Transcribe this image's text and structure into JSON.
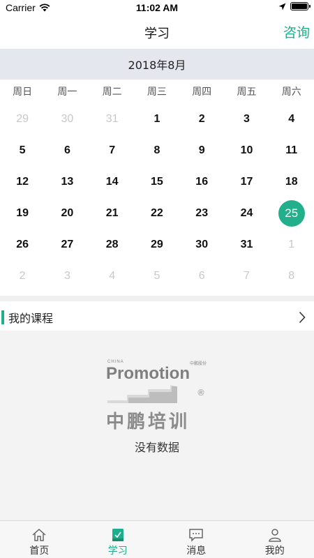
{
  "status_bar": {
    "carrier": "Carrier",
    "time": "11:02 AM"
  },
  "nav": {
    "title": "学习",
    "action": "咨询"
  },
  "calendar": {
    "month": "2018年8月",
    "weekdays": [
      "周日",
      "周一",
      "周二",
      "周三",
      "周四",
      "周五",
      "周六"
    ],
    "days": [
      {
        "d": "29",
        "muted": true
      },
      {
        "d": "30",
        "muted": true
      },
      {
        "d": "31",
        "muted": true
      },
      {
        "d": "1"
      },
      {
        "d": "2"
      },
      {
        "d": "3"
      },
      {
        "d": "4"
      },
      {
        "d": "5"
      },
      {
        "d": "6"
      },
      {
        "d": "7"
      },
      {
        "d": "8"
      },
      {
        "d": "9"
      },
      {
        "d": "10"
      },
      {
        "d": "11"
      },
      {
        "d": "12"
      },
      {
        "d": "13"
      },
      {
        "d": "14"
      },
      {
        "d": "15"
      },
      {
        "d": "16"
      },
      {
        "d": "17"
      },
      {
        "d": "18"
      },
      {
        "d": "19"
      },
      {
        "d": "20"
      },
      {
        "d": "21"
      },
      {
        "d": "22"
      },
      {
        "d": "23"
      },
      {
        "d": "24"
      },
      {
        "d": "25",
        "selected": true
      },
      {
        "d": "26"
      },
      {
        "d": "27"
      },
      {
        "d": "28"
      },
      {
        "d": "29"
      },
      {
        "d": "30"
      },
      {
        "d": "31"
      },
      {
        "d": "1",
        "muted": true
      },
      {
        "d": "2",
        "muted": true
      },
      {
        "d": "3",
        "muted": true
      },
      {
        "d": "4",
        "muted": true
      },
      {
        "d": "5",
        "muted": true
      },
      {
        "d": "6",
        "muted": true
      },
      {
        "d": "7",
        "muted": true
      },
      {
        "d": "8",
        "muted": true
      }
    ],
    "accent_color": "#22b08c"
  },
  "courses": {
    "title": "我的课程",
    "empty_text": "没有数据",
    "logo": {
      "small_left": "CHINA",
      "small_right": "中鹏股份",
      "word": "Promotion",
      "reg": "®",
      "cn": "中鹏培训"
    }
  },
  "tabs": [
    {
      "label": "首页",
      "icon": "home-icon"
    },
    {
      "label": "学习",
      "icon": "study-icon",
      "active": true
    },
    {
      "label": "消息",
      "icon": "message-icon"
    },
    {
      "label": "我的",
      "icon": "profile-icon"
    }
  ]
}
